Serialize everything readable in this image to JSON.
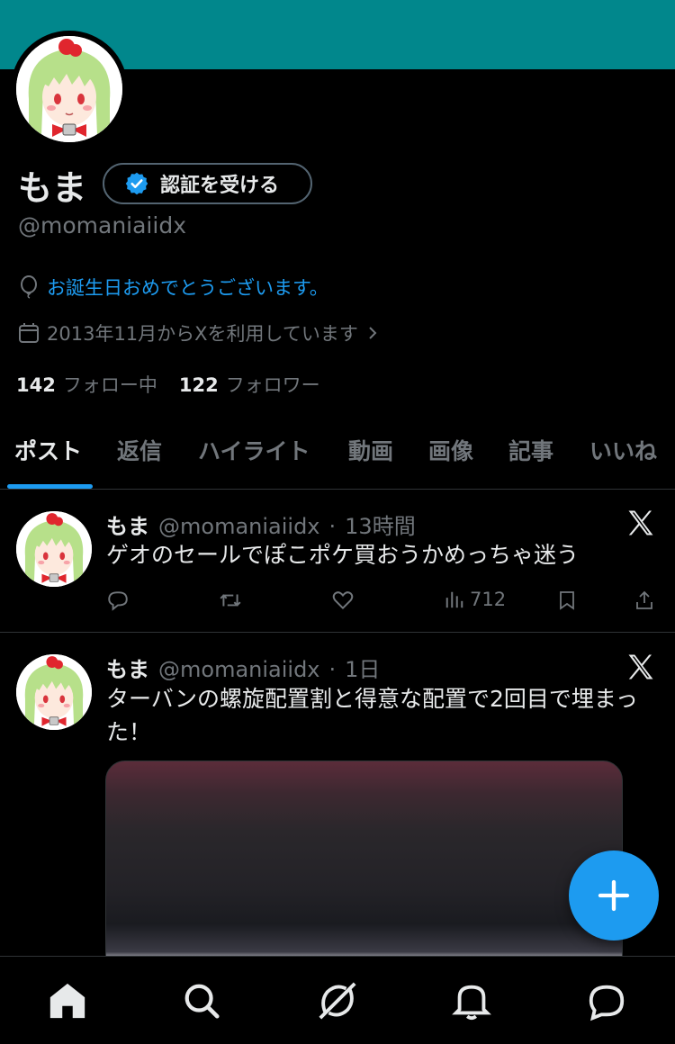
{
  "profile": {
    "name": "もま",
    "verify_label": "認証を受ける",
    "handle": "@momaniaiidx",
    "birthday_text": "お誕生日おめでとうございます。",
    "joined_text": "2013年11月からXを利用しています",
    "following_count": "142",
    "following_label": "フォロー中",
    "followers_count": "122",
    "followers_label": "フォロワー"
  },
  "tabs": [
    {
      "label": "ポスト",
      "active": true
    },
    {
      "label": "返信"
    },
    {
      "label": "ハイライト"
    },
    {
      "label": "動画"
    },
    {
      "label": "画像"
    },
    {
      "label": "記事"
    },
    {
      "label": "いいね"
    }
  ],
  "posts": [
    {
      "name": "もま",
      "handle": "@momaniaiidx",
      "time": "13時間",
      "text": "ゲオのセールでぽこポケ買おうかめっちゃ迷う",
      "views": "712"
    },
    {
      "name": "もま",
      "handle": "@momaniaiidx",
      "time": "1日",
      "text": "ターバンの螺旋配置割と得意な配置で2回目で埋まった！"
    }
  ],
  "colors": {
    "banner": "#01878c",
    "accent": "#1d9bf0",
    "background": "#000000",
    "muted": "#71767b"
  },
  "icons": [
    "verified-badge-icon",
    "balloon-icon",
    "calendar-icon",
    "chevron-right-icon",
    "x-logo-icon",
    "reply-icon",
    "repost-icon",
    "like-icon",
    "views-icon",
    "bookmark-icon",
    "share-icon",
    "compose-plus-icon",
    "home-icon",
    "search-icon",
    "grok-icon",
    "notifications-icon",
    "messages-icon"
  ]
}
